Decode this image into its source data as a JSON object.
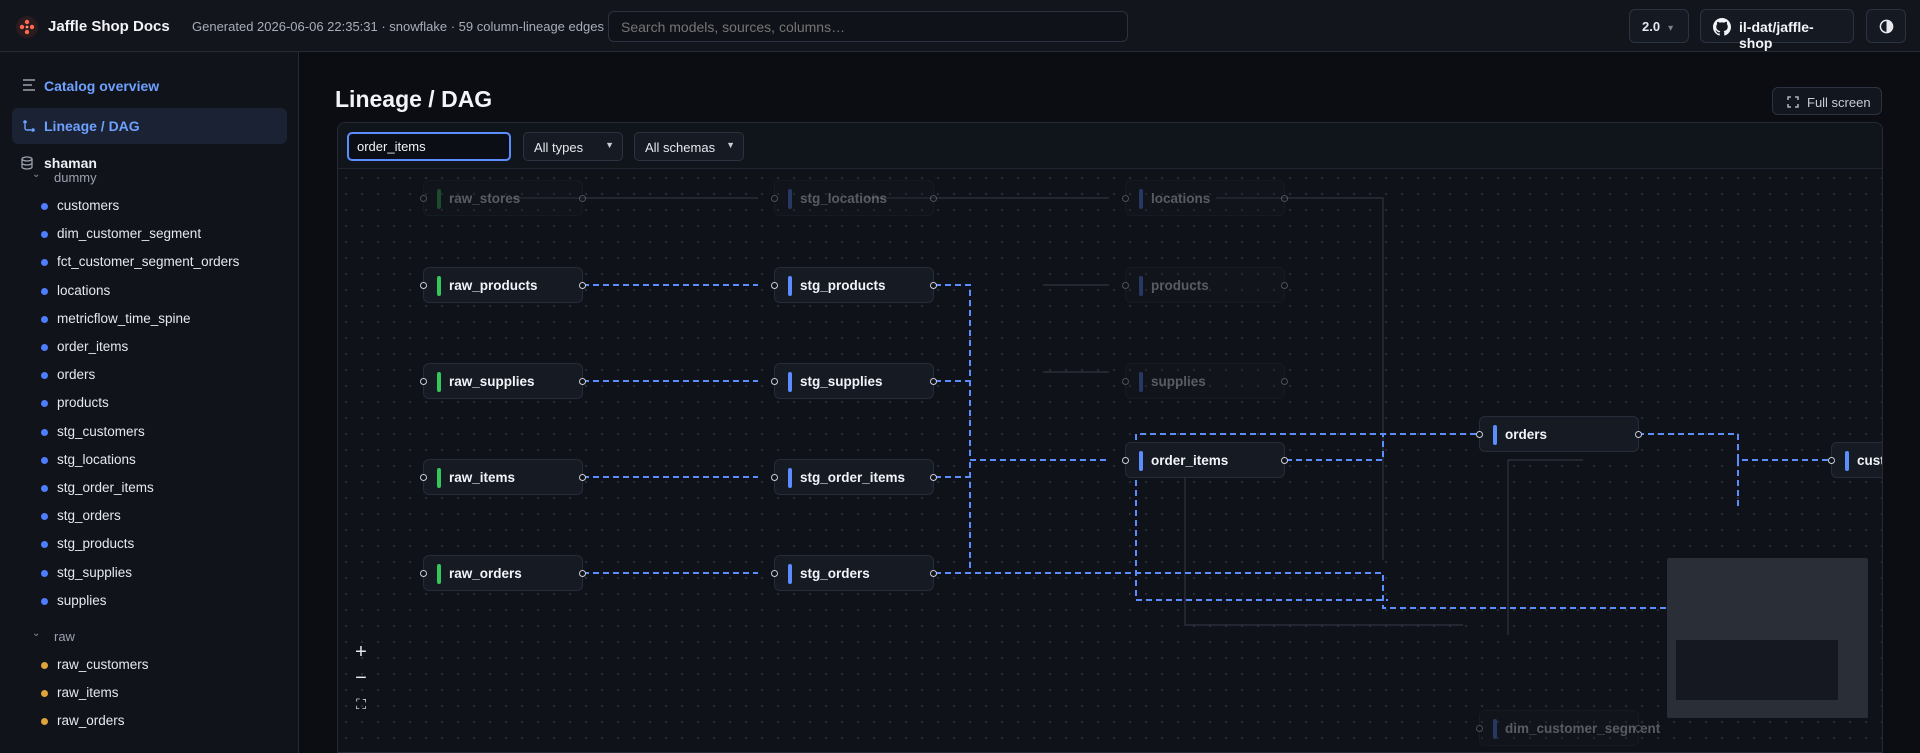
{
  "header": {
    "app_title": "Jaffle Shop Docs",
    "generated_meta": "Generated 2026-06-06 22:35:31 · snowflake · 59 column-lineage edges",
    "search_placeholder": "Search models, sources, columns…",
    "version": "2.0",
    "repo": "il-dat/jaffle-shop"
  },
  "sidebar": {
    "nav": [
      {
        "label": "Catalog overview",
        "icon": "list-icon"
      },
      {
        "label": "Lineage / DAG",
        "icon": "lineage-icon"
      }
    ],
    "database": "shaman",
    "folders": [
      {
        "name": "dummy",
        "items": [
          "customers",
          "dim_customer_segment",
          "fct_customer_segment_orders",
          "locations",
          "metricflow_time_spine",
          "order_items",
          "orders",
          "products",
          "stg_customers",
          "stg_locations",
          "stg_order_items",
          "stg_orders",
          "stg_products",
          "stg_supplies",
          "supplies"
        ]
      },
      {
        "name": "raw",
        "items": [
          "raw_customers",
          "raw_items",
          "raw_orders"
        ]
      }
    ],
    "colors": {
      "model_dot": "#4f7dff",
      "seed_dot": "#e0a33a"
    }
  },
  "main": {
    "title": "Lineage / DAG",
    "fullscreen_label": "Full screen",
    "filter_value": "order_items",
    "type_filter": "All types",
    "schema_filter": "All schemas"
  },
  "dag": {
    "colors": {
      "seed": "#34c759",
      "model": "#5b8dff",
      "edge_highlight": "#5b8dff"
    },
    "nodes": [
      {
        "id": "raw_stores",
        "label": "raw_stores",
        "kind": "seed",
        "dim": true
      },
      {
        "id": "stg_locations",
        "label": "stg_locations",
        "kind": "model",
        "dim": true
      },
      {
        "id": "locations",
        "label": "locations",
        "kind": "model",
        "dim": true
      },
      {
        "id": "raw_products",
        "label": "raw_products",
        "kind": "seed",
        "dim": false
      },
      {
        "id": "stg_products",
        "label": "stg_products",
        "kind": "model",
        "dim": false
      },
      {
        "id": "products",
        "label": "products",
        "kind": "model",
        "dim": true
      },
      {
        "id": "raw_supplies",
        "label": "raw_supplies",
        "kind": "seed",
        "dim": false
      },
      {
        "id": "stg_supplies",
        "label": "stg_supplies",
        "kind": "model",
        "dim": false
      },
      {
        "id": "supplies",
        "label": "supplies",
        "kind": "model",
        "dim": true
      },
      {
        "id": "orders",
        "label": "orders",
        "kind": "model",
        "dim": false
      },
      {
        "id": "raw_items",
        "label": "raw_items",
        "kind": "seed",
        "dim": false
      },
      {
        "id": "stg_order_items",
        "label": "stg_order_items",
        "kind": "model",
        "dim": false
      },
      {
        "id": "order_items",
        "label": "order_items",
        "kind": "model",
        "dim": false
      },
      {
        "id": "customers",
        "label": "cust",
        "kind": "model",
        "dim": false
      },
      {
        "id": "raw_orders",
        "label": "raw_orders",
        "kind": "seed",
        "dim": false
      },
      {
        "id": "stg_orders",
        "label": "stg_orders",
        "kind": "model",
        "dim": false
      },
      {
        "id": "dim_customer_segment",
        "label": "dim_customer_segment",
        "kind": "model",
        "dim": true
      }
    ]
  }
}
